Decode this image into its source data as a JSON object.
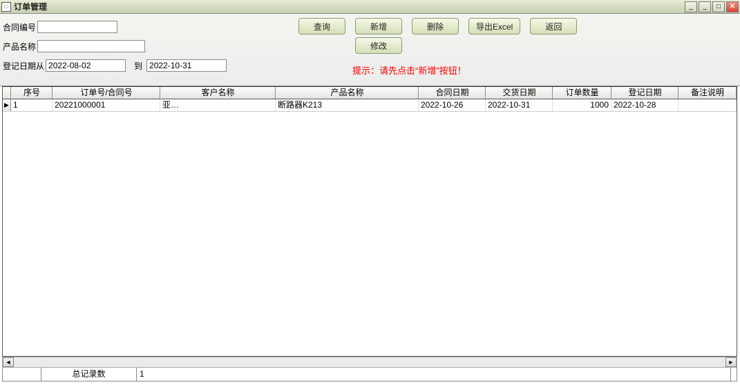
{
  "titlebar": {
    "title": "订单管理"
  },
  "form": {
    "contract_label": "合同编号",
    "contract_value": "",
    "product_label": "产品名称",
    "product_value": "",
    "date_from_label": "登记日期从",
    "date_from_value": "2022-08-02",
    "date_to_label": "到",
    "date_to_value": "2022-10-31"
  },
  "buttons": {
    "query": "查询",
    "add": "新增",
    "delete": "删除",
    "export_excel": "导出Excel",
    "back": "返回",
    "modify": "修改"
  },
  "hint": "提示：请先点击“新增”按钮！",
  "grid": {
    "headers": [
      "序号",
      "订单号/合同号",
      "客户名称",
      "产品名称",
      "合同日期",
      "交货日期",
      "订单数量",
      "登记日期",
      "备注说明"
    ],
    "rows": [
      {
        "seq": "1",
        "order_no": "20221000001",
        "customer": "亚…",
        "product": "断路器K213",
        "contract_date": "2022-10-26",
        "delivery_date": "2022-10-31",
        "qty": "1000",
        "reg_date": "2022-10-28",
        "remark": ""
      }
    ]
  },
  "statusbar": {
    "total_label": "总记录数",
    "total_value": "1"
  }
}
